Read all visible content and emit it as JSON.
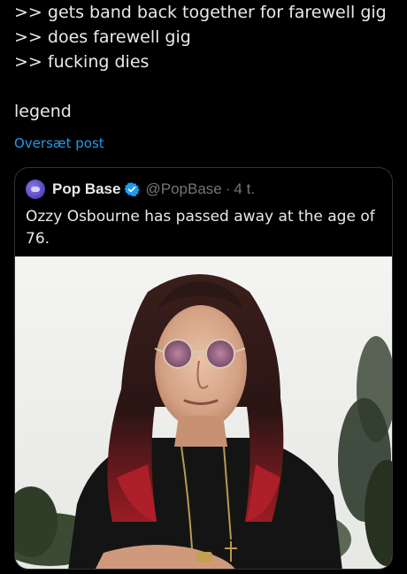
{
  "post": {
    "lines": [
      ">> gets band back together for farewell gig",
      ">> does farewell gig",
      ">> fucking dies"
    ],
    "closing": "legend",
    "translate_label": "Oversæt post"
  },
  "quote": {
    "author_name": "Pop Base",
    "handle": "@PopBase",
    "separator": "·",
    "time": "4 t.",
    "text": "Ozzy Osbourne has passed away at the age of 76.",
    "avatar_icon": "pop-base-avatar",
    "verified_icon": "verified-badge-icon",
    "image_subject": "photo-of-ozzy-osbourne"
  },
  "colors": {
    "background": "#000000",
    "text": "#e7e9ea",
    "secondary_text": "#71767b",
    "link": "#1d9bf0",
    "border": "#2f3336",
    "verified": "#1d9bf0"
  }
}
